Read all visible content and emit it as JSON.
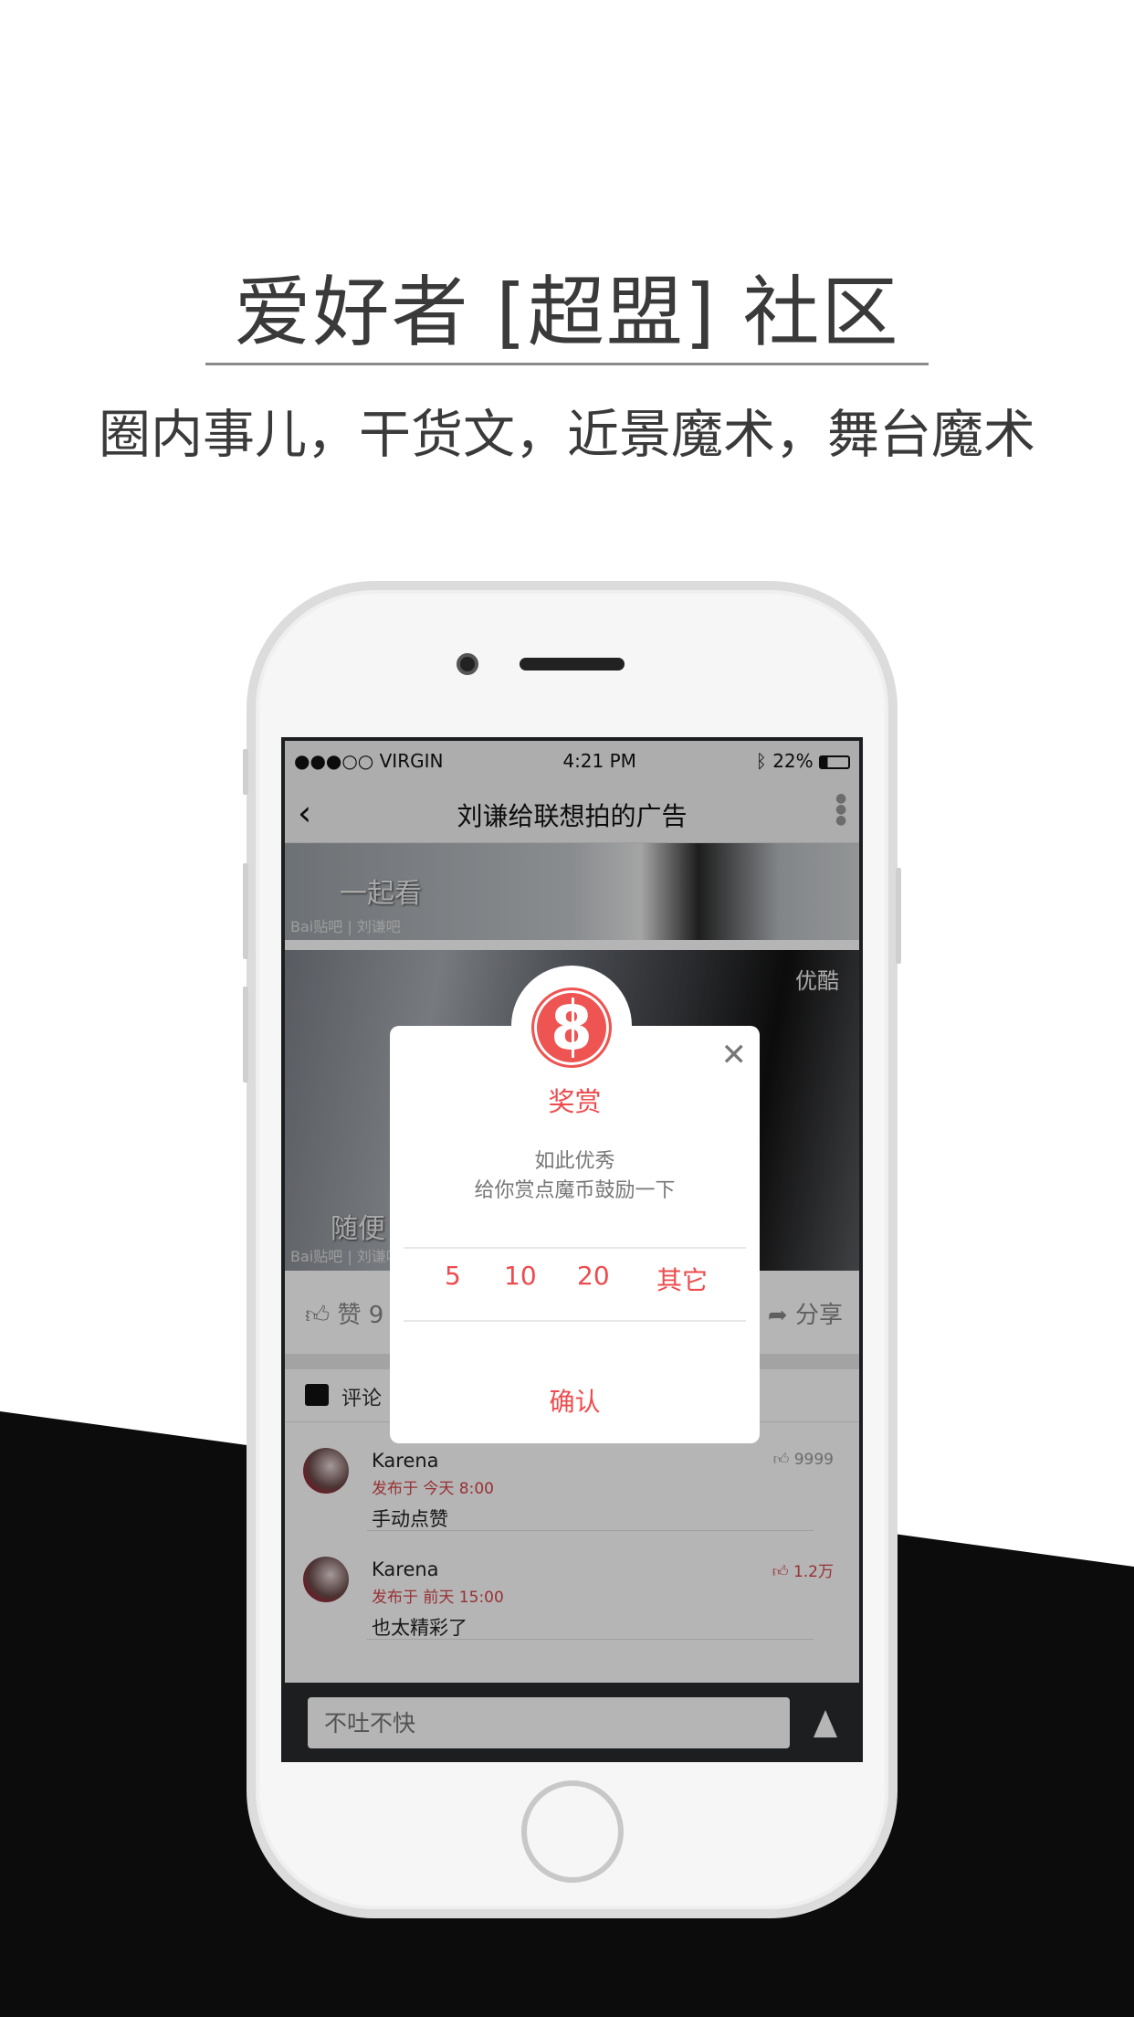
{
  "headline": "爱好者 [超盟] 社区",
  "subline": "圈内事儿，干货文，近景魔术，舞台魔术",
  "status_bar": {
    "carrier": "●●●○○ VIRGIN",
    "time": "4:21 PM",
    "battery": "22%"
  },
  "nav": {
    "title": "刘谦给联想拍的广告"
  },
  "video": {
    "caption1": "一起看",
    "caption2": "随便",
    "watermark": "Bai贴吧 | 刘谦吧",
    "logo": "优酷"
  },
  "actions": {
    "like": "赞 9",
    "share": "分享"
  },
  "comments_header": "评论",
  "comments": [
    {
      "name": "Karena",
      "time": "发布于 今天 8:00",
      "text": "手动点赞",
      "likes": "9999",
      "liked": false
    },
    {
      "name": "Karena",
      "time": "发布于 前天 15:00",
      "text": "也太精彩了",
      "likes": "1.2万",
      "liked": true
    }
  ],
  "input": {
    "placeholder": "不吐不快"
  },
  "dialog": {
    "title": "奖赏",
    "message1": "如此优秀",
    "message2": "给你赏点魔币鼓励一下",
    "amounts": [
      "5",
      "10",
      "20",
      "其它"
    ],
    "confirm": "确认"
  },
  "colors": {
    "accent": "#ee4b4e"
  }
}
